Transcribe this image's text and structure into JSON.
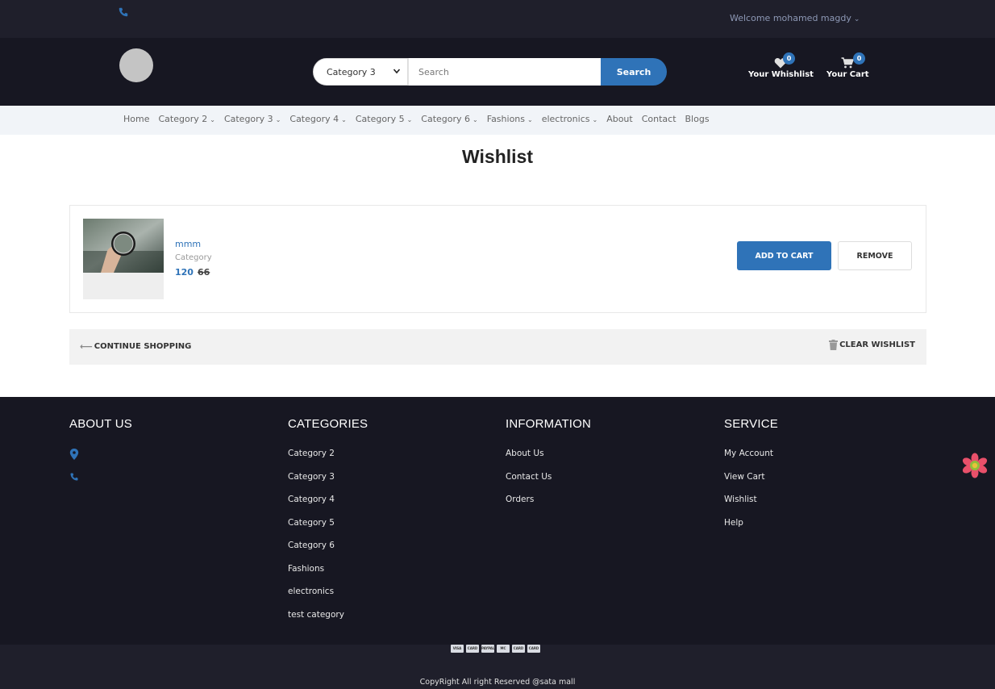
{
  "topbar": {
    "welcome": "Welcome mohamed magdy"
  },
  "header": {
    "category_select": "Category 3",
    "search_placeholder": "Search",
    "search_button": "Search",
    "wishlist_label": "Your Whishlist",
    "wishlist_count": "0",
    "cart_label": "Your Cart",
    "cart_count": "0"
  },
  "nav": {
    "items": [
      {
        "label": "Home",
        "dropdown": false
      },
      {
        "label": "Category 2",
        "dropdown": true
      },
      {
        "label": "Category 3",
        "dropdown": true
      },
      {
        "label": "Category 4",
        "dropdown": true
      },
      {
        "label": "Category 5",
        "dropdown": true
      },
      {
        "label": "Category 6",
        "dropdown": true
      },
      {
        "label": "Fashions",
        "dropdown": true
      },
      {
        "label": "electronics",
        "dropdown": true
      },
      {
        "label": "About",
        "dropdown": false
      },
      {
        "label": "Contact",
        "dropdown": false
      },
      {
        "label": "Blogs",
        "dropdown": false
      }
    ]
  },
  "page": {
    "title": "Wishlist"
  },
  "wishlist_item": {
    "name": "mmm",
    "category": "Category",
    "price": "120",
    "old_price": "66",
    "add_to_cart": "ADD TO CART",
    "remove": "REMOVE"
  },
  "actions": {
    "continue_shopping": "CONTINUE SHOPPING",
    "clear_wishlist": "CLEAR WISHLIST"
  },
  "footer": {
    "about_title": "ABOUT US",
    "categories_title": "CATEGORIES",
    "categories": [
      "Category 2",
      "Category 3",
      "Category 4",
      "Category 5",
      "Category 6",
      "Fashions",
      "electronics",
      "test category"
    ],
    "information_title": "INFORMATION",
    "information": [
      "About Us",
      "Contact Us",
      "Orders"
    ],
    "service_title": "SERVICE",
    "service": [
      "My Account",
      "View Cart",
      "Wishlist",
      "Help"
    ],
    "payments": [
      "VISA",
      "CARD",
      "PAYPAL",
      "MC",
      "CARD",
      "CARD"
    ],
    "copyright": "CopyRight All right Reserved @sata mall"
  },
  "colors": {
    "accent": "#2f73b8",
    "header_bg": "#171722",
    "topbar_bg": "#1f1f2b",
    "nav_bg": "#f1f4f8"
  }
}
